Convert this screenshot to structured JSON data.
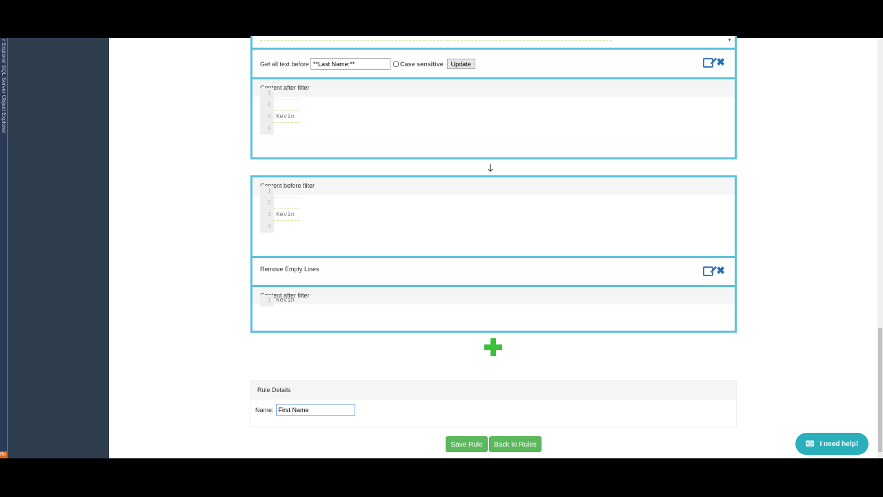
{
  "sidebar": {
    "vertical_text": "r Explorer   SQL Server Object Explorer",
    "badge": "Re"
  },
  "filter1": {
    "label": "Get all text before",
    "input_value": "**Last Name:**",
    "case_label": "Case sensitive",
    "update_label": "Update"
  },
  "after1": {
    "title": "Content after filter",
    "lines": [
      {
        "n": "1",
        "t": ""
      },
      {
        "n": "2",
        "t": ""
      },
      {
        "n": "3",
        "t": "Kevin"
      },
      {
        "n": "4",
        "t": ""
      }
    ]
  },
  "before2": {
    "title": "Content before filter",
    "lines": [
      {
        "n": "1",
        "t": ""
      },
      {
        "n": "2",
        "t": ""
      },
      {
        "n": "3",
        "t": "Kevin"
      },
      {
        "n": "4",
        "t": ""
      }
    ]
  },
  "filter2": {
    "label": "Remove Empty Lines"
  },
  "after2": {
    "title": "Content after filter",
    "lines": [
      {
        "n": "1",
        "t": "Kevin"
      }
    ]
  },
  "rule": {
    "title": "Rule Details",
    "name_label": "Name:",
    "name_value": "First Name"
  },
  "buttons": {
    "save": "Save Rule",
    "back": "Back to Rules"
  },
  "help": {
    "label": "I need help!"
  },
  "colors": {
    "panel_border": "#5bc0de",
    "accent_green": "#5cb85c",
    "help": "#2bb0bb"
  }
}
